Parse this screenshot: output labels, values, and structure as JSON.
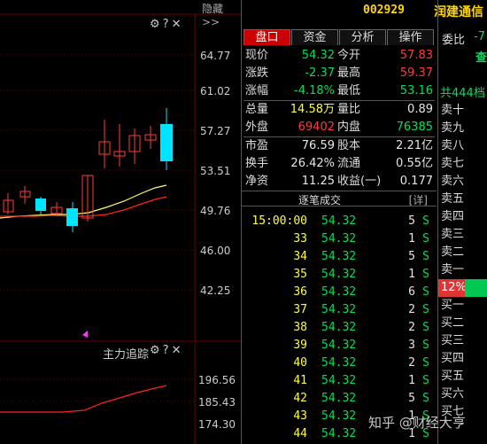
{
  "toolbar": {
    "hide_label": "隐藏",
    "hide_arrows": ">>"
  },
  "main_chart": {
    "icons": [
      "gear-icon",
      "question-icon",
      "close-icon"
    ],
    "icon_glyphs": [
      "⚙",
      "?",
      "✕"
    ],
    "price_ticks": [
      "64.77",
      "61.02",
      "57.27",
      "53.51",
      "49.76",
      "46.00",
      "42.25"
    ]
  },
  "indicator_chart": {
    "title": "主力追踪",
    "icon_glyphs": [
      "⚙",
      "?",
      "✕"
    ],
    "ticks": [
      "196.56",
      "185.43",
      "174.30"
    ]
  },
  "stock": {
    "code": "002929",
    "name": "润建通信"
  },
  "tabs": [
    {
      "label": "盘口",
      "active": true
    },
    {
      "label": "资金",
      "active": false
    },
    {
      "label": "分析",
      "active": false
    },
    {
      "label": "操作",
      "active": false
    }
  ],
  "quote": {
    "rows": [
      {
        "l1": "现价",
        "v1": "54.32",
        "c1": "green",
        "l2": "今开",
        "v2": "57.83",
        "c2": "red"
      },
      {
        "l1": "涨跌",
        "v1": "-2.37",
        "c1": "green",
        "l2": "最高",
        "v2": "59.37",
        "c2": "red"
      },
      {
        "l1": "涨幅",
        "v1": "-4.18%",
        "c1": "green",
        "l2": "最低",
        "v2": "53.16",
        "c2": "green"
      },
      {
        "l1": "总量",
        "v1": "14.58万",
        "c1": "yellow",
        "l2": "量比",
        "v2": "0.89",
        "c2": "white"
      },
      {
        "l1": "外盘",
        "v1": "69402",
        "c1": "red",
        "l2": "内盘",
        "v2": "76385",
        "c2": "green"
      },
      {
        "l1": "市盈",
        "v1": "76.59",
        "c1": "white",
        "l2": "股本",
        "v2": "2.21亿",
        "c2": "white"
      },
      {
        "l1": "换手",
        "v1": "26.42%",
        "c1": "white",
        "l2": "流通",
        "v2": "0.55亿",
        "c2": "white"
      },
      {
        "l1": "净资",
        "v1": "11.25",
        "c1": "white",
        "l2": "收益(一)",
        "v2": "0.177",
        "c2": "white"
      }
    ]
  },
  "ticks_header": {
    "title": "逐笔成交",
    "detail": "[详]"
  },
  "ticks": [
    {
      "time": "15:00:00",
      "price": "54.32",
      "vol": "5",
      "side": "S"
    },
    {
      "time": "33",
      "price": "54.32",
      "vol": "1",
      "side": "S"
    },
    {
      "time": "34",
      "price": "54.32",
      "vol": "5",
      "side": "S"
    },
    {
      "time": "35",
      "price": "54.32",
      "vol": "1",
      "side": "S"
    },
    {
      "time": "36",
      "price": "54.32",
      "vol": "6",
      "side": "S"
    },
    {
      "time": "37",
      "price": "54.32",
      "vol": "2",
      "side": "S"
    },
    {
      "time": "38",
      "price": "54.32",
      "vol": "2",
      "side": "S"
    },
    {
      "time": "39",
      "price": "54.32",
      "vol": "3",
      "side": "S"
    },
    {
      "time": "40",
      "price": "54.32",
      "vol": "2",
      "side": "S"
    },
    {
      "time": "41",
      "price": "54.32",
      "vol": "1",
      "side": "S"
    },
    {
      "time": "42",
      "price": "54.32",
      "vol": "5",
      "side": "S"
    },
    {
      "time": "43",
      "price": "54.32",
      "vol": "1",
      "side": "S"
    },
    {
      "time": "44",
      "price": "54.32",
      "vol": "1",
      "side": "S"
    }
  ],
  "book": {
    "weibi_label": "委比",
    "weibi_value": "-7",
    "cha_label": "查",
    "total_label": "共444档",
    "levels": [
      "卖十",
      "卖九",
      "卖八",
      "卖七",
      "卖六",
      "卖五",
      "卖四",
      "卖三",
      "卖二",
      "卖一"
    ],
    "ratio_label": "12%",
    "buy_levels": [
      "买一",
      "买二",
      "买三",
      "买四",
      "买五",
      "买六",
      "买七"
    ]
  },
  "watermark": "知乎 @财经大亨",
  "colors": {
    "up": "#ff3b3b",
    "down": "#00e5ff",
    "ma_yellow": "#ffff66",
    "ma_red": "#ff2222"
  }
}
